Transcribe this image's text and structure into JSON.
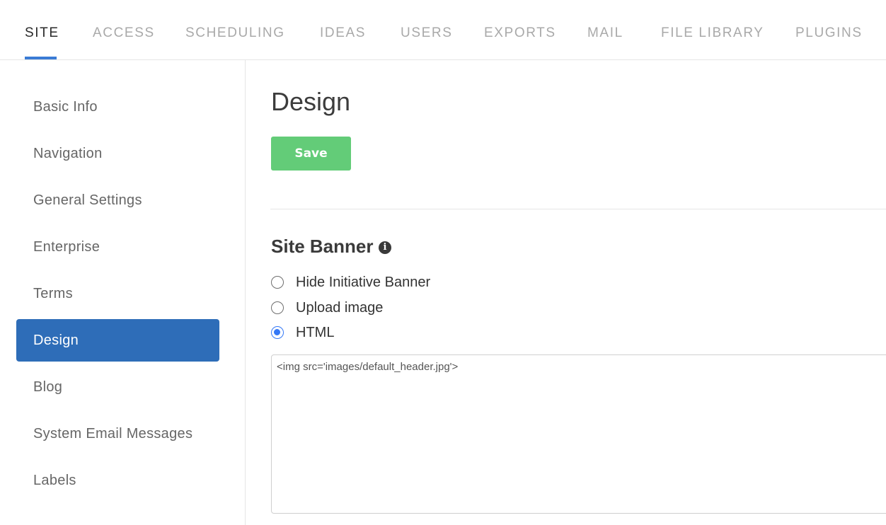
{
  "topnav": {
    "tabs": [
      {
        "label": "SITE",
        "active": true
      },
      {
        "label": "ACCESS"
      },
      {
        "label": "SCHEDULING"
      },
      {
        "label": "IDEAS"
      },
      {
        "label": "USERS"
      },
      {
        "label": "EXPORTS"
      },
      {
        "label": "MAIL"
      },
      {
        "label": "FILE LIBRARY"
      },
      {
        "label": "PLUGINS"
      }
    ]
  },
  "sidebar": {
    "items": [
      {
        "label": "Basic Info"
      },
      {
        "label": "Navigation"
      },
      {
        "label": "General Settings"
      },
      {
        "label": "Enterprise"
      },
      {
        "label": "Terms"
      },
      {
        "label": "Design",
        "active": true
      },
      {
        "label": "Blog"
      },
      {
        "label": "System Email Messages"
      },
      {
        "label": "Labels"
      }
    ]
  },
  "main": {
    "title": "Design",
    "save_label": "Save",
    "section_title": "Site Banner",
    "info_icon": "info-circle-icon",
    "banner_options": [
      {
        "label": "Hide Initiative Banner",
        "checked": false
      },
      {
        "label": "Upload image",
        "checked": false
      },
      {
        "label": "HTML",
        "checked": true
      }
    ],
    "html_value": "<img src='images/default_header.jpg'>"
  },
  "colors": {
    "accent": "#3a7bd5",
    "sidebar_active": "#2e6db8",
    "save_button": "#63cc78",
    "radio_checked": "#3478f6"
  }
}
